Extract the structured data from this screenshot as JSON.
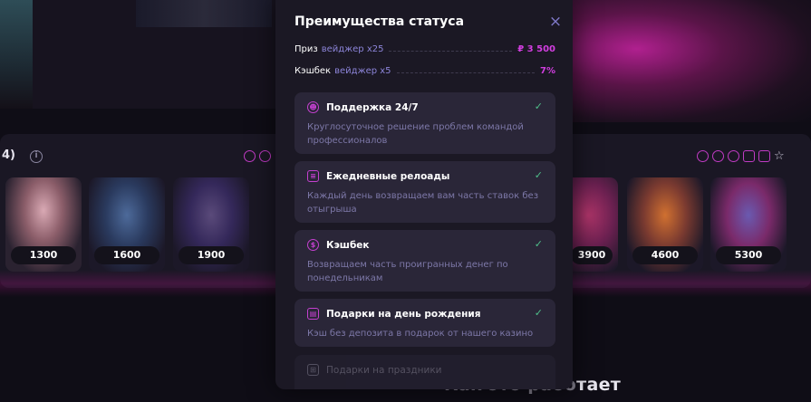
{
  "background": {
    "section_number": "4)",
    "info_icon": "i",
    "cards": [
      {
        "price": "1300"
      },
      {
        "price": "1600"
      },
      {
        "price": "1900"
      },
      {
        "price": "3900"
      },
      {
        "price": "4600"
      },
      {
        "price": "5300"
      }
    ],
    "bottom_title_dim": "Как это рабо",
    "bottom_title_bright": "тает"
  },
  "modal": {
    "title": "Преимущества статуса",
    "close_icon": "×",
    "stats": [
      {
        "label": "Приз",
        "sub": "вейджер x25",
        "value": "₽ 3 500"
      },
      {
        "label": "Кэшбек",
        "sub": "вейджер x5",
        "value": "7%"
      }
    ],
    "benefits": [
      {
        "icon": "support-icon",
        "title": "Поддержка 24/7",
        "desc": "Круглосуточное решение проблем командой профессионалов",
        "check": "✓"
      },
      {
        "icon": "coins-stack-icon",
        "title": "Ежедневные релоады",
        "desc": "Каждый день возвращаем вам часть ставок без отыгрыша",
        "check": "✓"
      },
      {
        "icon": "dollar-coin-icon",
        "title": "Кэшбек",
        "desc": "Возвращаем часть проигранных денег по понедельникам",
        "check": "✓"
      },
      {
        "icon": "birthday-cake-icon",
        "title": "Подарки на день рождения",
        "desc": "Кэш без депозита в подарок от нашего казино",
        "check": "✓"
      },
      {
        "icon": "gift-icon",
        "title": "Подарки на праздники",
        "desc": "",
        "check": ""
      }
    ]
  },
  "colors": {
    "accent_pink": "#d23ee0",
    "accent_violet": "#8c84d8",
    "check_green": "#4fbf8a",
    "modal_bg": "#1b1824",
    "card_bg": "#2a2638"
  }
}
